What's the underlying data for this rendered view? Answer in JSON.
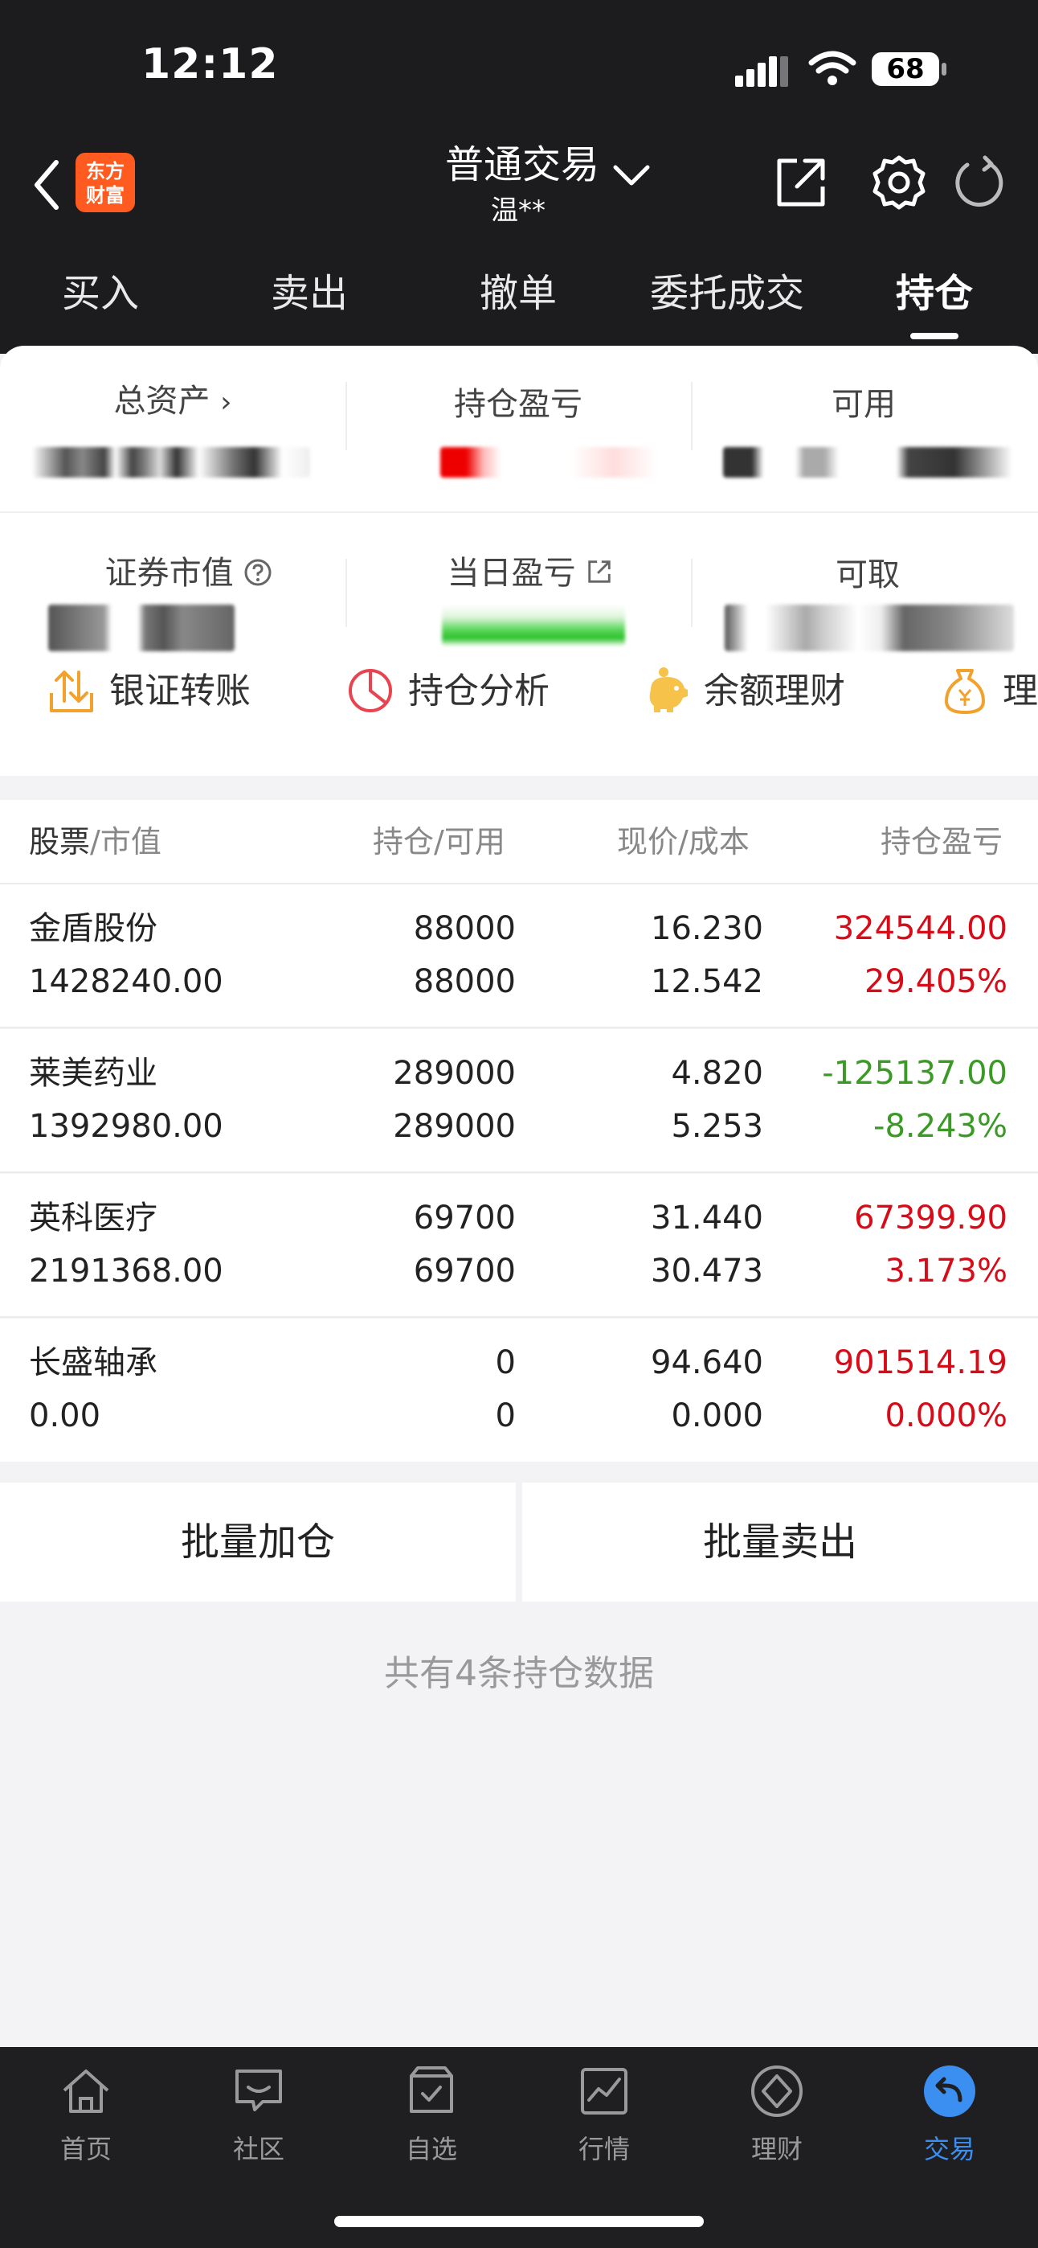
{
  "status_bar": {
    "time": "12:12",
    "battery": "68"
  },
  "nav": {
    "logo_line1": "东方",
    "logo_line2": "财富",
    "title": "普通交易",
    "account": "温**"
  },
  "tabs": [
    {
      "label": "买入"
    },
    {
      "label": "卖出"
    },
    {
      "label": "撤单"
    },
    {
      "label": "委托成交"
    },
    {
      "label": "持仓"
    }
  ],
  "summary": {
    "total_assets_label": "总资产",
    "position_pl_label": "持仓盈亏",
    "available_label": "可用",
    "market_value_label": "证券市值",
    "daily_pl_label": "当日盈亏",
    "withdrawable_label": "可取"
  },
  "quick_actions": [
    {
      "label": "银证转账",
      "icon": "transfer-icon"
    },
    {
      "label": "持仓分析",
      "icon": "pie-chart-icon"
    },
    {
      "label": "余额理财",
      "icon": "piggy-bank-icon"
    },
    {
      "label": "理财",
      "icon": "money-bag-icon"
    }
  ],
  "table": {
    "headers": {
      "stock": "股票",
      "market_value": "/市值",
      "holding": "持仓",
      "available": "/可用",
      "price": "现价",
      "cost": "/成本",
      "pl": "持仓盈亏"
    },
    "rows": [
      {
        "name": "金盾股份",
        "market_value": "1428240.00",
        "holding": "88000",
        "available": "88000",
        "price": "16.230",
        "cost": "12.542",
        "pl": "324544.00",
        "pl_pct": "29.405%",
        "trend": "up"
      },
      {
        "name": "莱美药业",
        "market_value": "1392980.00",
        "holding": "289000",
        "available": "289000",
        "price": "4.820",
        "cost": "5.253",
        "pl": "-125137.00",
        "pl_pct": "-8.243%",
        "trend": "down"
      },
      {
        "name": "英科医疗",
        "market_value": "2191368.00",
        "holding": "69700",
        "available": "69700",
        "price": "31.440",
        "cost": "30.473",
        "pl": "67399.90",
        "pl_pct": "3.173%",
        "trend": "up"
      },
      {
        "name": "长盛轴承",
        "market_value": "0.00",
        "holding": "0",
        "available": "0",
        "price": "94.640",
        "cost": "0.000",
        "pl": "901514.19",
        "pl_pct": "0.000%",
        "trend": "up"
      }
    ]
  },
  "actions": {
    "batch_add": "批量加仓",
    "batch_sell": "批量卖出"
  },
  "footer_text": "共有4条持仓数据",
  "tabbar": [
    {
      "label": "首页",
      "icon": "home-icon"
    },
    {
      "label": "社区",
      "icon": "chat-icon"
    },
    {
      "label": "自选",
      "icon": "checklist-icon"
    },
    {
      "label": "行情",
      "icon": "chart-icon"
    },
    {
      "label": "理财",
      "icon": "diamond-icon"
    },
    {
      "label": "交易",
      "icon": "trade-icon"
    }
  ],
  "colors": {
    "up": "#d80c18",
    "down": "#3b9a26",
    "accent": "#3a8ff0",
    "brand": "#ff5a1f"
  }
}
